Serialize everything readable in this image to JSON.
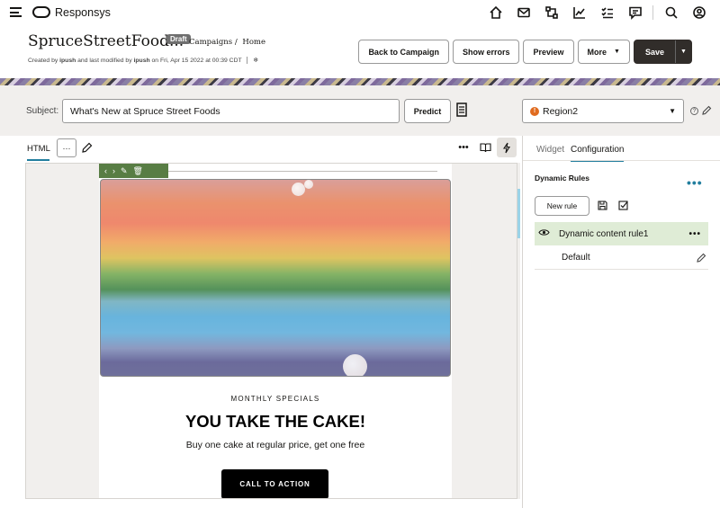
{
  "app": {
    "brand": "Responsys"
  },
  "topnav": {
    "icons": [
      "home-icon",
      "mail-icon",
      "routes-icon",
      "analytics-icon",
      "tasks-icon",
      "messages-icon",
      "search-icon",
      "user-icon"
    ]
  },
  "header": {
    "title": "SpruceStreetFood...",
    "badge": "Draft",
    "breadcrumbs": [
      "Campaigns /",
      "Home"
    ],
    "meta_prefix": "Created by",
    "created_by": "ipush",
    "meta_mid": "and last modified by",
    "modified_by": "ipush",
    "meta_on": "on Fri, Apr 15 2022 at 00:39 CDT",
    "buttons": {
      "back": "Back to Campaign",
      "errors": "Show errors",
      "preview": "Preview",
      "more": "More",
      "save": "Save"
    }
  },
  "subject": {
    "label": "Subject:",
    "value": "What's New at Spruce Street Foods",
    "predict": "Predict",
    "region": "Region2",
    "region_badge": "!"
  },
  "editor": {
    "tab": "HTML",
    "more": "···"
  },
  "email": {
    "kicker": "MONTHLY SPECIALS",
    "headline": "YOU TAKE THE CAKE!",
    "subline": "Buy one cake at regular price, get one free",
    "cta": "CALL TO ACTION"
  },
  "panel": {
    "tabs": {
      "widget": "Widget",
      "configuration": "Configuration"
    },
    "dynamic_title": "Dynamic Rules",
    "new_rule": "New rule",
    "rule": "Dynamic content rule1",
    "default": "Default"
  },
  "colors": {
    "accent": "#227e9e",
    "toolbar_green": "#587d44",
    "rule_bg": "#dfecd6",
    "save_bg": "#312d2a"
  }
}
